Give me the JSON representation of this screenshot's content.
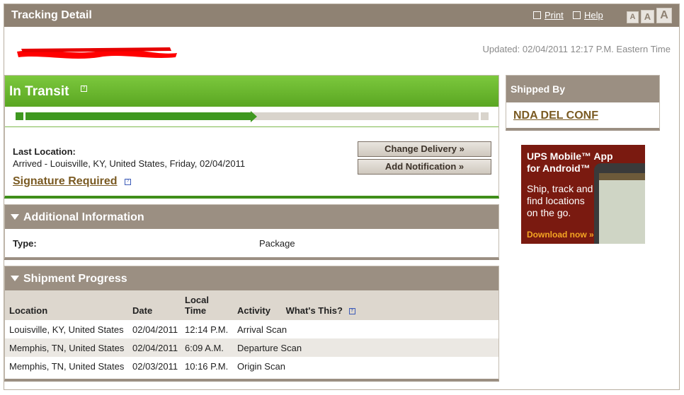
{
  "header": {
    "title": "Tracking Detail",
    "print_label": "Print",
    "help_label": "Help",
    "font_sizes": [
      "A",
      "A",
      "A"
    ]
  },
  "updated_text": "Updated: 02/04/2011 12:17 P.M. Eastern Time",
  "status": {
    "title": "In Transit",
    "help_glyph": "?",
    "progress_fraction": 0.5,
    "last_location_label": "Last Location:",
    "last_location_value": "Arrived - Louisville, KY, United States, Friday, 02/04/2011",
    "signature_label": "Signature Required",
    "change_delivery_label": "Change Delivery »",
    "add_notification_label": "Add Notification »"
  },
  "additional_info": {
    "title": "Additional Information",
    "type_label": "Type:",
    "type_value": "Package"
  },
  "shipment_progress": {
    "title": "Shipment Progress",
    "columns": [
      "Location",
      "Date",
      "Local Time",
      "Activity",
      "What's This?"
    ],
    "rows": [
      [
        "Louisville, KY, United States",
        "02/04/2011",
        "12:14 P.M.",
        "Arrival Scan"
      ],
      [
        "Memphis, TN, United States",
        "02/04/2011",
        "6:09 A.M.",
        "Departure Scan"
      ],
      [
        "Memphis, TN, United States",
        "02/03/2011",
        "10:16 P.M.",
        "Origin Scan"
      ]
    ]
  },
  "shipped_by": {
    "title": "Shipped By",
    "value": "NDA DEL CONF"
  },
  "ad": {
    "title": "UPS Mobile™ App for Android™",
    "body": "Ship, track and find locations on the go.",
    "cta": "Download now »"
  },
  "colors": {
    "header_bg": "#8f8273",
    "transit_green": "#6fbd32",
    "progress_green": "#3f9820",
    "section_header": "#9b8f82",
    "link_brown": "#7a5a22",
    "ad_bg": "#7a1a10"
  }
}
